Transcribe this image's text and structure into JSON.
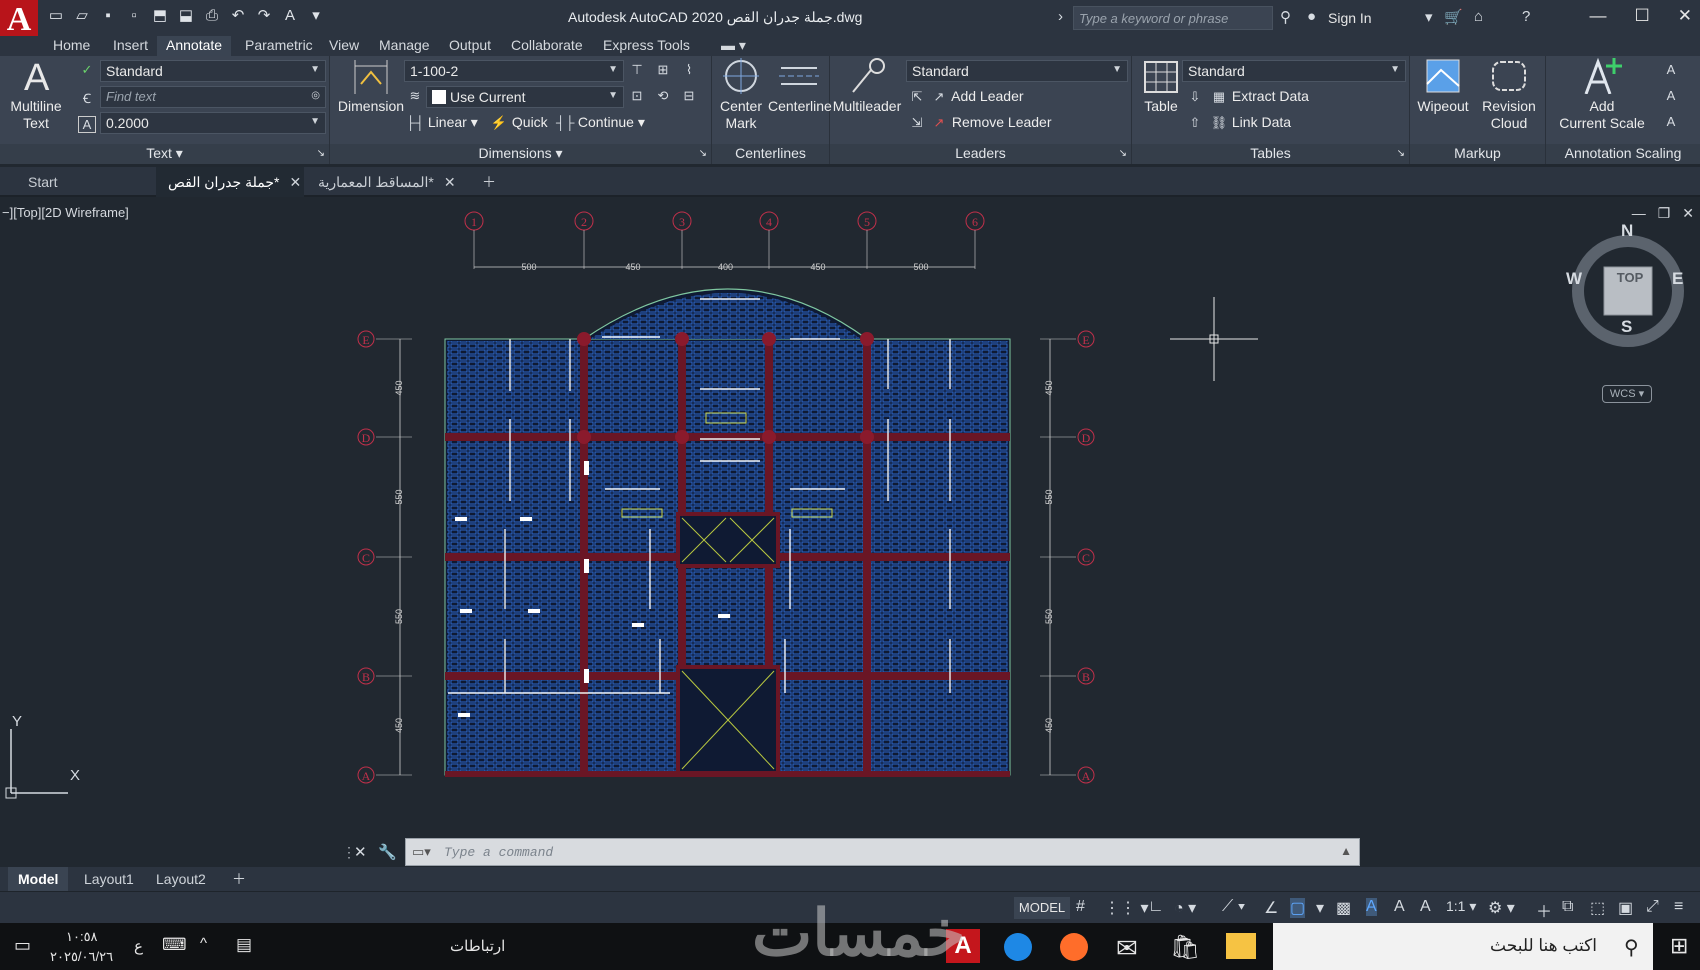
{
  "window": {
    "title": "Autodesk AutoCAD 2020   جملة جدران القص.dwg",
    "search_placeholder": "Type a keyword or phrase",
    "sign_in": "Sign In",
    "logo_letter": "A"
  },
  "ribbon_tabs": [
    "Home",
    "Insert",
    "Annotate",
    "Parametric",
    "View",
    "Manage",
    "Output",
    "Collaborate",
    "Express Tools"
  ],
  "active_ribbon_tab": "Annotate",
  "text_panel": {
    "big_label": "Multiline Text",
    "big_label_1": "Multiline",
    "big_label_2": "Text",
    "style": "Standard",
    "find_placeholder": "Find text",
    "height": "0.2000",
    "title": "Text"
  },
  "dimensions_panel": {
    "big_label": "Dimension",
    "dim_style": "1-100-2",
    "layer": "Use Current",
    "linear": "Linear",
    "quick": "Quick",
    "continue": "Continue",
    "title": "Dimensions"
  },
  "centerlines_panel": {
    "center_mark_1": "Center",
    "center_mark_2": "Mark",
    "centerline": "Centerline",
    "title": "Centerlines"
  },
  "leaders_panel": {
    "big_label": "Multileader",
    "style": "Standard",
    "add_leader": "Add Leader",
    "remove_leader": "Remove Leader",
    "title": "Leaders"
  },
  "tables_panel": {
    "big_label": "Table",
    "style": "Standard",
    "extract_data": "Extract Data",
    "link_data": "Link Data",
    "title": "Tables"
  },
  "markup_panel": {
    "wipeout": "Wipeout",
    "revision_1": "Revision",
    "revision_2": "Cloud",
    "title": "Markup"
  },
  "scaling_panel": {
    "add_1": "Add",
    "add_2": "Current Scale",
    "title": "Annotation Scaling"
  },
  "doc_tabs": [
    "Start",
    "جملة جدران القص*",
    "المساقط المعمارية*"
  ],
  "viewport": {
    "label": "−][Top][2D Wireframe]",
    "cube_top": "TOP",
    "cube_n": "N",
    "cube_s": "S",
    "cube_e": "E",
    "cube_w": "W",
    "wcs": "WCS",
    "ucs_y": "Y",
    "ucs_x": "X"
  },
  "drawing": {
    "grid_numbers": [
      "1",
      "2",
      "3",
      "4",
      "5",
      "6"
    ],
    "grid_letters": [
      "E",
      "D",
      "C",
      "B",
      "A"
    ],
    "top_dims": [
      "500",
      "450",
      "400",
      "450",
      "500"
    ],
    "side_dims": [
      "450",
      "550",
      "550",
      "450"
    ],
    "colors": {
      "grid": "#c0304a",
      "panel": "#2f6fd8",
      "slab_edge": "#7fc7a0",
      "beam": "#6a1625",
      "dim": "#d0d0d0",
      "ok": "#e0e040"
    }
  },
  "command": {
    "placeholder": "Type a command"
  },
  "layout_tabs": [
    "Model",
    "Layout1",
    "Layout2"
  ],
  "status": {
    "model": "MODEL",
    "scale": "1:1"
  },
  "taskbar": {
    "search": "اكتب هنا للبحث",
    "time": "١٠:٥٨",
    "date": "٢٠٢٥/٠٦/٢٦",
    "lang": "ع",
    "links": "ارتباطات",
    "watermark": "خمسات"
  }
}
